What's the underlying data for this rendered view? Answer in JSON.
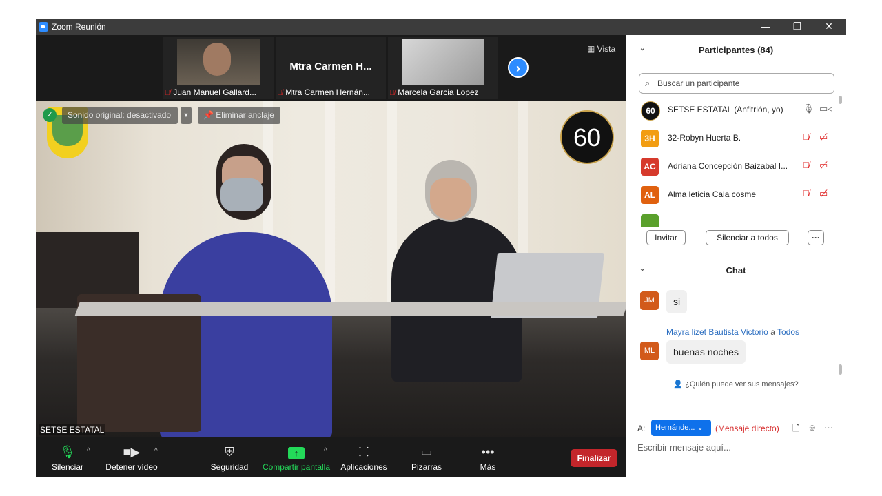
{
  "window": {
    "title": "Zoom Reunión",
    "minimize": "—",
    "restore": "❐",
    "close": "✕"
  },
  "thumbnails": [
    {
      "name": "Juan Manuel Gallard..."
    },
    {
      "display": "Mtra Carmen H...",
      "name": "Mtra Carmen Hernán..."
    },
    {
      "name": "Marcela Garcia Lopez"
    }
  ],
  "view_label": "Vista",
  "main_video": {
    "original_sound": "Sonido original: desactivado",
    "unpin": "Eliminar anclaje",
    "speaker": "SETSE ESTATAL",
    "badge_60": "60"
  },
  "toolbar": {
    "mute": "Silenciar",
    "stop_video": "Detener vídeo",
    "security": "Seguridad",
    "share": "Compartir pantalla",
    "apps": "Aplicaciones",
    "whiteboards": "Pizarras",
    "more": "Más",
    "end": "Finalizar"
  },
  "colors": {
    "share_green": "#23d959",
    "end_red": "#c3262b",
    "accent_blue": "#0e71eb"
  },
  "participants": {
    "header": "Participantes (84)",
    "search_placeholder": "Buscar un participante",
    "list": [
      {
        "initials": "60",
        "name": "SETSE ESTATAL (Anfitrión, yo)",
        "color": "#111111"
      },
      {
        "initials": "3H",
        "name": "32-Robyn Huerta B.",
        "color": "#f29d12"
      },
      {
        "initials": "AC",
        "name": "Adriana Concepción Baizabal I...",
        "color": "#d63a2c"
      },
      {
        "initials": "AL",
        "name": "Alma leticia Cala cosme",
        "color": "#e0610f"
      }
    ],
    "invite": "Invitar",
    "mute_all": "Silenciar a todos",
    "more": "···"
  },
  "chat": {
    "header": "Chat",
    "messages": [
      {
        "initials": "JM",
        "text": "si"
      },
      {
        "sender": "Mayra lizet Bautista Victorio",
        "connector": "a",
        "recipient": "Todos",
        "initials": "ML",
        "text": "buenas noches"
      }
    ],
    "who_can_see": "¿Quién puede ver sus mensajes?",
    "to_label": "A:",
    "to_value": "Hernánde...",
    "direct": "(Mensaje directo)",
    "placeholder": "Escribir mensaje aquí..."
  }
}
